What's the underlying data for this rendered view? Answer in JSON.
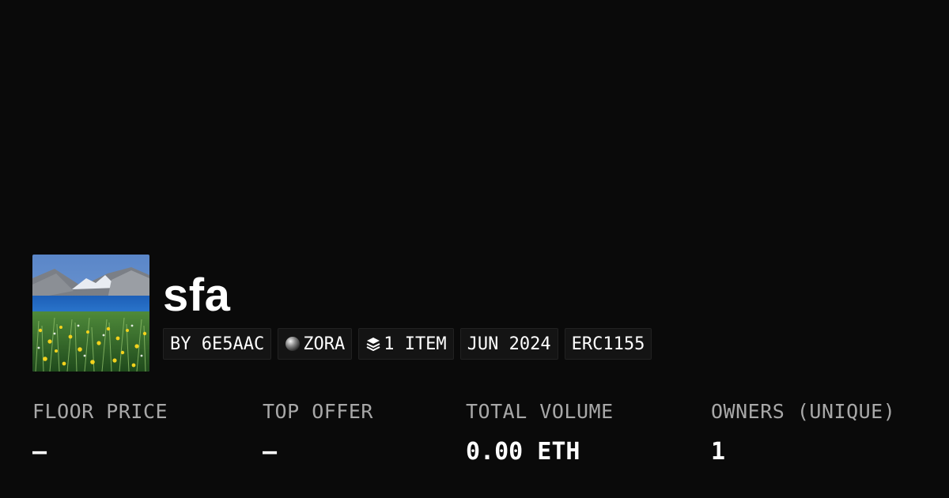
{
  "collection": {
    "name": "sfa",
    "image_alt": "painting of mountains over a blue lake with a field of yellow flowers"
  },
  "tags": [
    {
      "label": "BY 6E5AAC",
      "icon": ""
    },
    {
      "label": "ZORA",
      "icon": "zora-orb-icon"
    },
    {
      "label": "1 ITEM",
      "icon": "layers-icon"
    },
    {
      "label": "JUN 2024",
      "icon": ""
    },
    {
      "label": "ERC1155",
      "icon": ""
    }
  ],
  "stats": {
    "floor_price": {
      "label": "FLOOR PRICE",
      "value": "–"
    },
    "top_offer": {
      "label": "TOP OFFER",
      "value": "–"
    },
    "total_volume": {
      "label": "TOTAL VOLUME",
      "value": "0.00 ETH"
    },
    "owners": {
      "label": "OWNERS (UNIQUE)",
      "value": "1"
    }
  },
  "colors": {
    "background": "#0a0a0a",
    "tag_background": "#141414",
    "label_gray": "#a8a8a8",
    "text": "#ffffff"
  }
}
